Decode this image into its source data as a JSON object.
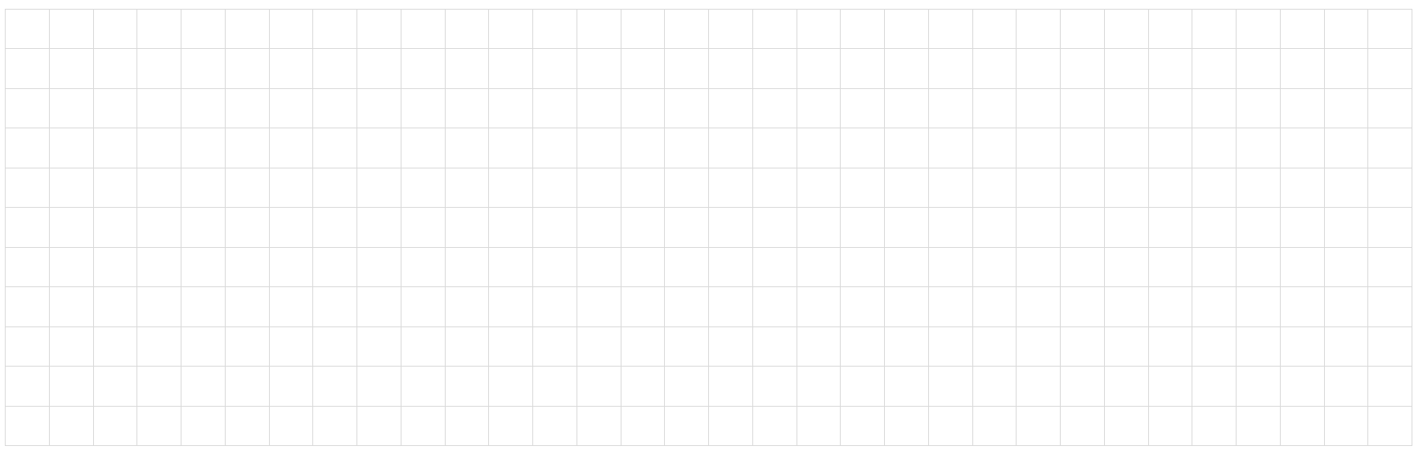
{
  "grid": {
    "rows": 11,
    "columns": 32,
    "cells_empty": true,
    "line_color": "#d9d9d9",
    "background": "#ffffff"
  }
}
